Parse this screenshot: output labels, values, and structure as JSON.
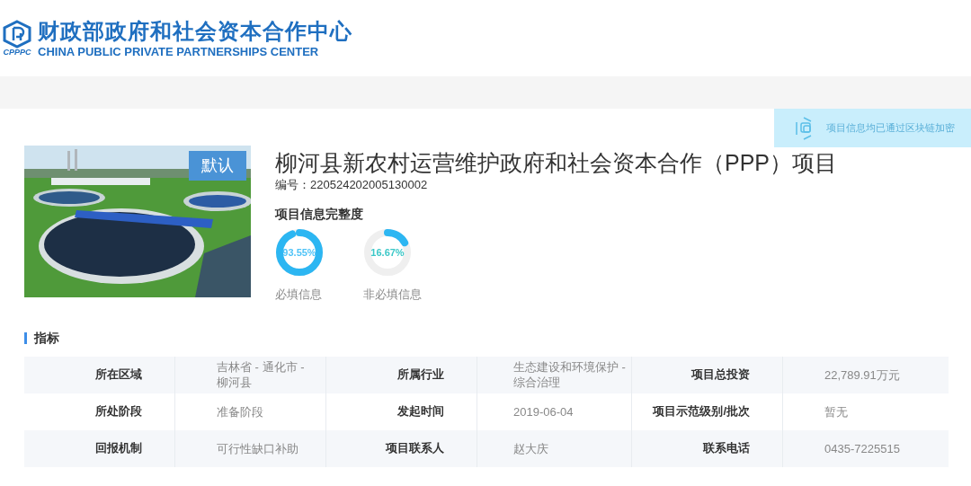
{
  "header": {
    "logo_text": "CPPPC",
    "title": "财政部政府和社会资本合作中心",
    "subtitle": "CHINA PUBLIC PRIVATE PARTNERSHIPS CENTER"
  },
  "notice": {
    "text": "项目信息均已通过区块链加密"
  },
  "project": {
    "image": {
      "kind": "picture",
      "badge": "默认"
    },
    "title": "柳河县新农村运营维护政府和社会资本合作（PPP）项目",
    "code": "编号：220524202005130002",
    "completeness_title": "项目信息完整度",
    "meters": [
      {
        "reading": "93.55%",
        "level": 0.9355,
        "label": "必填信息",
        "color": "#4fc3f7"
      },
      {
        "reading": "16.67%",
        "level": 0.1667,
        "label": "非必填信息",
        "color": "#3cc8c8"
      }
    ]
  },
  "section": {
    "title": "指标"
  },
  "table": {
    "rows": [
      {
        "cells": [
          {
            "label": "所在区域",
            "value": "吉林省 - 通化市 - 柳河县"
          },
          {
            "label": "所属行业",
            "value": "生态建设和环境保护 - 综合治理"
          },
          {
            "label": "项目总投资",
            "value": "22,789.91万元"
          }
        ]
      },
      {
        "cells": [
          {
            "label": "所处阶段",
            "value": "准备阶段"
          },
          {
            "label": "发起时间",
            "value": "2019-06-04"
          },
          {
            "label": "项目示范级别/批次",
            "value": "暂无"
          }
        ]
      },
      {
        "cells": [
          {
            "label": "回报机制",
            "value": "可行性缺口补助"
          },
          {
            "label": "项目联系人",
            "value": "赵大庆"
          },
          {
            "label": "联系电话",
            "value": "0435-7225515"
          }
        ]
      }
    ]
  }
}
